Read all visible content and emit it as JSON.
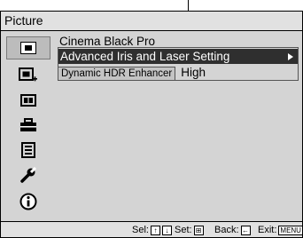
{
  "menu": {
    "title": "Picture"
  },
  "sidebar": {
    "items": [
      {
        "icon": "picture-icon",
        "selected": true
      },
      {
        "icon": "picture-plus-icon"
      },
      {
        "icon": "screen-icon"
      },
      {
        "icon": "setup-toolbox-icon"
      },
      {
        "icon": "function-icon"
      },
      {
        "icon": "installation-wrench-icon"
      },
      {
        "icon": "information-icon"
      }
    ]
  },
  "content": {
    "row1": "Cinema Black Pro",
    "row2": "Advanced Iris and Laser Setting",
    "row3": {
      "label": "Dynamic HDR Enhancer",
      "value": "High"
    }
  },
  "footer": {
    "sel_label": "Sel:",
    "set_label": "Set:",
    "back_label": "Back:",
    "exit_label": "Exit:",
    "exit_key": "MENU"
  }
}
